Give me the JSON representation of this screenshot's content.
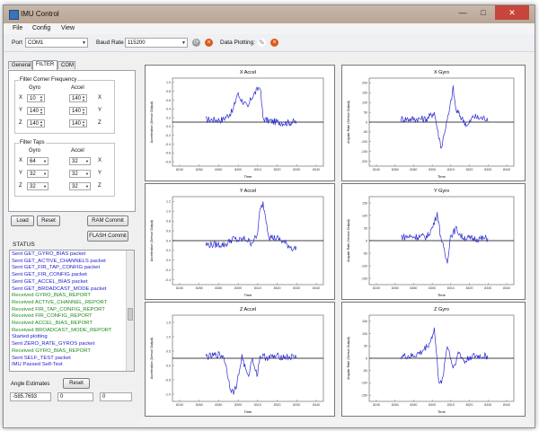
{
  "window": {
    "title": "IMU Control",
    "minimize": "—",
    "maximize": "□",
    "close": "✕"
  },
  "menu": [
    "File",
    "Config",
    "View"
  ],
  "toolbar": {
    "port_label": "Port",
    "port_value": "COM1",
    "baud_label": "Baud Rate",
    "baud_value": "115200",
    "plotting_label": "Data Plotting:",
    "refresh_icon": "refresh-icon",
    "stop_icon": "stop-icon",
    "pencil_icon": "pencil-icon"
  },
  "tabs": [
    {
      "label": "General"
    },
    {
      "label": "FILTER"
    },
    {
      "label": "COM"
    }
  ],
  "filter_corner": {
    "title": "Filter Corner Frequency",
    "gyro_header": "Gyro",
    "accel_header": "Accel",
    "rows": [
      {
        "axis": "X",
        "gyro": "10",
        "accel": "140",
        "axis2": "X"
      },
      {
        "axis": "Y",
        "gyro": "140",
        "accel": "140",
        "axis2": "Y"
      },
      {
        "axis": "Z",
        "gyro": "140",
        "accel": "140",
        "axis2": "Z"
      }
    ]
  },
  "filter_taps": {
    "title": "Filter Taps",
    "gyro_header": "Gyro",
    "accel_header": "Accel",
    "rows": [
      {
        "axis": "X",
        "gyro": "64",
        "accel": "32",
        "axis2": "X"
      },
      {
        "axis": "Y",
        "gyro": "32",
        "accel": "32",
        "axis2": "Y"
      },
      {
        "axis": "Z",
        "gyro": "32",
        "accel": "32",
        "axis2": "Z"
      }
    ]
  },
  "buttons": {
    "load": "Load",
    "reset": "Reset",
    "ram_commit": "RAM Commit",
    "flash_commit": "FLASH Commit",
    "angle_reset": "Reset"
  },
  "status": {
    "label": "STATUS",
    "lines": [
      {
        "text": "Sent GET_GYRO_BIAS packet",
        "color": "#2222cc"
      },
      {
        "text": "Sent GET_ACTIVE_CHANNELS packet",
        "color": "#2222cc"
      },
      {
        "text": "Sent GET_FIR_TAP_CONFIG packet",
        "color": "#2222cc"
      },
      {
        "text": "Sent GET_FIR_CONFIG packet",
        "color": "#2222cc"
      },
      {
        "text": "Sent GET_ACCEL_BIAS packet",
        "color": "#2222cc"
      },
      {
        "text": "Sent GET_BRDADCAST_MODE packet",
        "color": "#2222cc"
      },
      {
        "text": "Received GYRO_BIAS_REPORT",
        "color": "#1e8a1e"
      },
      {
        "text": "Received ACTIVE_CHANNEL_REPORT",
        "color": "#1e8a1e"
      },
      {
        "text": "Received FIR_TAP_CONFIG_REPORT",
        "color": "#1e8a1e"
      },
      {
        "text": "Received FIR_CONFIG_REPORT",
        "color": "#1e8a1e"
      },
      {
        "text": "Received ACCEL_BIAS_REPORT",
        "color": "#1e8a1e"
      },
      {
        "text": "Received BROADCAST_MODE_REPORT",
        "color": "#1e8a1e"
      },
      {
        "text": "Started plotting",
        "color": "#2222cc"
      },
      {
        "text": "Sent ZERO_RATE_GYROS packet",
        "color": "#2222cc"
      },
      {
        "text": "Received GYRO_BIAS_REPORT",
        "color": "#1e8a1e"
      },
      {
        "text": "Sent SELF_TEST packet",
        "color": "#2222cc"
      },
      {
        "text": "IMU Passed Self-Test",
        "color": "#2222cc"
      }
    ]
  },
  "angle": {
    "label": "Angle Estimates",
    "v1": "-585.7693",
    "v2": "0",
    "v3": "0"
  },
  "plots": [
    {
      "title": "X Accel",
      "xlabel": "Time",
      "ylabel": "Acceleration (Sensor Output)",
      "yticks": [
        "1.0",
        "0.8",
        "0.6",
        "0.4",
        "0.2",
        "0.0",
        "-0.2",
        "-0.4",
        "-0.6",
        "-0.8"
      ],
      "xticks": [
        "8240",
        "8260",
        "8280",
        "8300",
        "8310",
        "8320",
        "8330",
        "8340"
      ]
    },
    {
      "title": "X Gyro",
      "xlabel": "Time",
      "ylabel": "Angular Rate (Sensor Output)",
      "yticks": [
        "200",
        "150",
        "100",
        "50",
        "0",
        "-50",
        "-100",
        "-150",
        "-200"
      ],
      "xticks": [
        "8240",
        "8260",
        "8280",
        "8300",
        "8310",
        "8320",
        "8330",
        "8340"
      ]
    },
    {
      "title": "Y Accel",
      "xlabel": "Time",
      "ylabel": "Acceleration (Sensor Output)",
      "yticks": [
        "1.2",
        "1.0",
        "0.8",
        "0.6",
        "0.4",
        "0.2",
        "0.0",
        "-0.2",
        "-0.4"
      ],
      "xticks": [
        "8240",
        "8260",
        "8280",
        "8300",
        "8310",
        "8320",
        "8330",
        "8340"
      ]
    },
    {
      "title": "Y Gyro",
      "xlabel": "Time",
      "ylabel": "Angular Rate (Sensor Output)",
      "yticks": [
        "150",
        "100",
        "50",
        "0",
        "-50",
        "-100",
        "-150"
      ],
      "xticks": [
        "8240",
        "8260",
        "8280",
        "8300",
        "8310",
        "8320",
        "8330",
        "8340"
      ]
    },
    {
      "title": "Z Accel",
      "xlabel": "Time",
      "ylabel": "Acceleration (Sensor Output)",
      "yticks": [
        "1.5",
        "1.0",
        "0.5",
        "0.0",
        "-0.5",
        "-1.0"
      ],
      "xticks": [
        "8240",
        "8260",
        "8280",
        "8300",
        "8310",
        "8320",
        "8330",
        "8340"
      ]
    },
    {
      "title": "Z Gyro",
      "xlabel": "Time",
      "ylabel": "Angular Rate (Sensor Output)",
      "yticks": [
        "150",
        "100",
        "50",
        "0",
        "-50",
        "-100",
        "-150"
      ],
      "xticks": [
        "8240",
        "8260",
        "8280",
        "8300",
        "8310",
        "8320",
        "8330",
        "8340"
      ]
    }
  ]
}
